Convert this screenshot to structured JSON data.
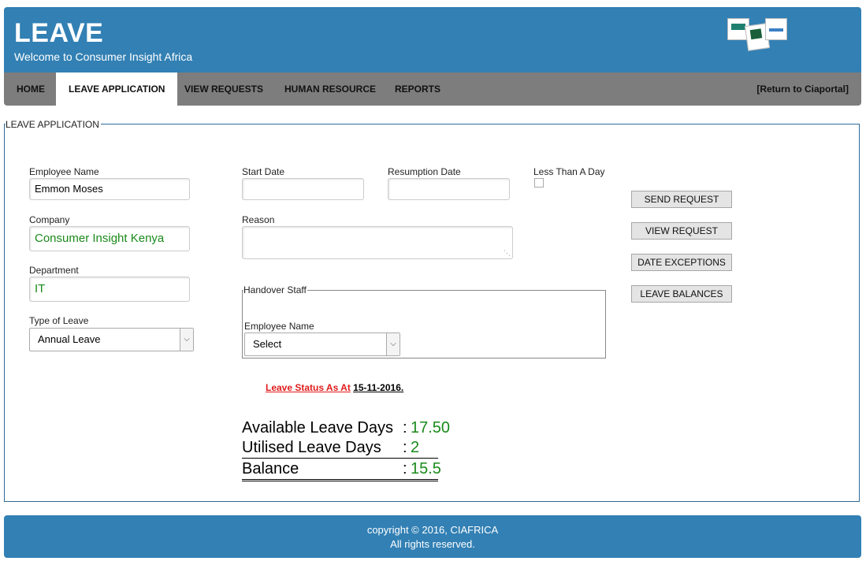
{
  "header": {
    "title": "LEAVE",
    "subtitle": "Welcome to Consumer Insight Africa"
  },
  "nav": {
    "items": [
      {
        "label": "HOME",
        "active": false
      },
      {
        "label": "LEAVE APPLICATION",
        "active": true
      },
      {
        "label": "VIEW REQUESTS",
        "active": false
      },
      {
        "label": "HUMAN RESOURCE",
        "active": false
      },
      {
        "label": "REPORTS",
        "active": false
      }
    ],
    "return_link": "[Return to Ciaportal]"
  },
  "form": {
    "legend": "LEAVE APPLICATION",
    "employee_name_label": "Employee Name",
    "employee_name_value": "Emmon Moses",
    "company_label": "Company",
    "company_value": "Consumer Insight Kenya",
    "department_label": "Department",
    "department_value": "IT",
    "type_of_leave_label": "Type of Leave",
    "type_of_leave_value": "Annual Leave",
    "start_date_label": "Start Date",
    "start_date_value": "",
    "resumption_date_label": "Resumption Date",
    "resumption_date_value": "",
    "less_than_day_label": "Less Than A Day",
    "less_than_day_checked": false,
    "reason_label": "Reason",
    "reason_value": "",
    "handover": {
      "legend": "Handover Staff",
      "employee_name_label": "Employee Name",
      "employee_select_value": "Select"
    }
  },
  "buttons": {
    "send_request": "SEND REQUEST",
    "view_request": "VIEW REQUEST",
    "date_exceptions": "DATE EXCEPTIONS",
    "leave_balances": "LEAVE BALANCES"
  },
  "status": {
    "prefix": "Leave Status As At",
    "date": "15-11-2016."
  },
  "balances": {
    "available_label": "Available Leave Days",
    "available_value": "17.50",
    "utilised_label": "Utilised Leave Days",
    "utilised_value": "2",
    "balance_label": "Balance",
    "balance_value": "15.5",
    "separator": ":"
  },
  "footer": {
    "line1": "copyright © 2016, CIAFRICA",
    "line2": "All rights reserved."
  },
  "colors": {
    "header_bg": "#3280b4",
    "nav_bg": "#7d7d7d",
    "value_green": "#1a8a1a",
    "status_red": "#e01b1b"
  }
}
